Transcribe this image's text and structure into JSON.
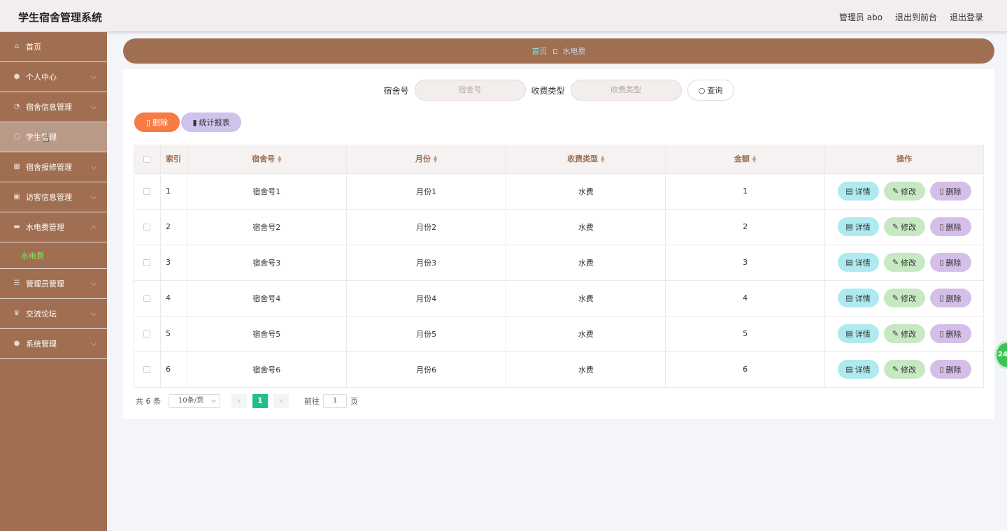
{
  "header": {
    "title": "学生宿舍管理系统",
    "admin_label": "管理员 abo",
    "frontend_link": "退出到前台",
    "logout_link": "退出登录"
  },
  "sidebar": {
    "items": [
      {
        "label": "首页",
        "icon": "home-icon",
        "expandable": false
      },
      {
        "label": "个人中心",
        "icon": "user-icon",
        "expandable": true
      },
      {
        "label": "宿舍信息管理",
        "icon": "clock-icon",
        "expandable": true
      },
      {
        "label": "学生管理",
        "icon": "square-icon",
        "expandable": true,
        "hover": true
      },
      {
        "label": "宿舍报修管理",
        "icon": "grid-icon",
        "expandable": true
      },
      {
        "label": "访客信息管理",
        "icon": "lock-icon",
        "expandable": true
      },
      {
        "label": "水电费管理",
        "icon": "truck-icon",
        "expandable": true,
        "expanded": true,
        "sub": [
          "水电费"
        ]
      },
      {
        "label": "管理员管理",
        "icon": "list-icon",
        "expandable": true
      },
      {
        "label": "交流论坛",
        "icon": "trophy-icon",
        "expandable": true
      },
      {
        "label": "系统管理",
        "icon": "bulb-icon",
        "expandable": true
      }
    ]
  },
  "breadcrumb": {
    "home": "首页",
    "current": "水电费"
  },
  "search": {
    "dorm_label": "宿舍号",
    "dorm_placeholder": "宿舍号",
    "fee_label": "收费类型",
    "fee_placeholder": "收费类型",
    "query_label": "查询"
  },
  "actions": {
    "delete_label": "删除",
    "stats_label": "统计报表"
  },
  "table": {
    "headers": {
      "index": "索引",
      "dorm": "宿舍号",
      "month": "月份",
      "fee_type": "收费类型",
      "amount": "金额",
      "ops": "操作"
    },
    "op_labels": {
      "detail": "详情",
      "edit": "修改",
      "delete": "删除"
    },
    "rows": [
      {
        "index": "1",
        "dorm": "宿舍号1",
        "month": "月份1",
        "fee_type": "水费",
        "amount": "1"
      },
      {
        "index": "2",
        "dorm": "宿舍号2",
        "month": "月份2",
        "fee_type": "水费",
        "amount": "2"
      },
      {
        "index": "3",
        "dorm": "宿舍号3",
        "month": "月份3",
        "fee_type": "水费",
        "amount": "3"
      },
      {
        "index": "4",
        "dorm": "宿舍号4",
        "month": "月份4",
        "fee_type": "水费",
        "amount": "4"
      },
      {
        "index": "5",
        "dorm": "宿舍号5",
        "month": "月份5",
        "fee_type": "水费",
        "amount": "5"
      },
      {
        "index": "6",
        "dorm": "宿舍号6",
        "month": "月份6",
        "fee_type": "水费",
        "amount": "6"
      }
    ]
  },
  "pagination": {
    "total": "共 6 条",
    "page_size": "10条/页",
    "prev": "‹",
    "current": "1",
    "next": "›",
    "goto_label": "前往",
    "goto_value": "1",
    "page_unit": "页"
  },
  "float_badge": "24",
  "colors": {
    "brand": "#a06f51",
    "delete": "#f77b45",
    "stats": "#cdc3eb",
    "detail": "#aeeaef",
    "edit": "#c7e8c3",
    "row_delete": "#d5bfe8",
    "page_active": "#1fbf8f"
  }
}
